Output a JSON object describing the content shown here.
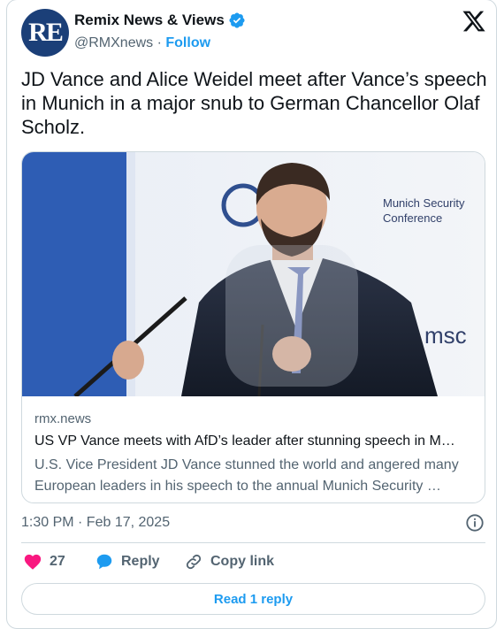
{
  "account": {
    "avatar_text": "RE",
    "display_name": "Remix News & Views",
    "handle": "@RMXnews",
    "separator": " · ",
    "follow_label": "Follow",
    "verified": true
  },
  "tweet": {
    "text": "JD Vance and Alice Weidel meet after Vance’s speech in Munich in a major snub to German Chancellor Olaf Scholz."
  },
  "link_card": {
    "image_text_line1": "Munich Security",
    "image_text_line2": "Conference",
    "image_logo_text": "msc",
    "domain": "rmx.news",
    "title": "US VP Vance meets with AfD’s leader after stunning speech in M…",
    "description": "U.S. Vice President JD Vance stunned the world and angered many European leaders in his speech to the annual Munich Security …"
  },
  "meta": {
    "timestamp": "1:30 PM · Feb 17, 2025"
  },
  "actions": {
    "like_count": "27",
    "reply_label": "Reply",
    "copy_link_label": "Copy link",
    "read_replies_label": "Read 1 reply"
  },
  "colors": {
    "accent": "#1d9bf0",
    "like": "#f91880",
    "text": "#0f1419",
    "muted": "#536471",
    "border": "#cfd9de"
  }
}
